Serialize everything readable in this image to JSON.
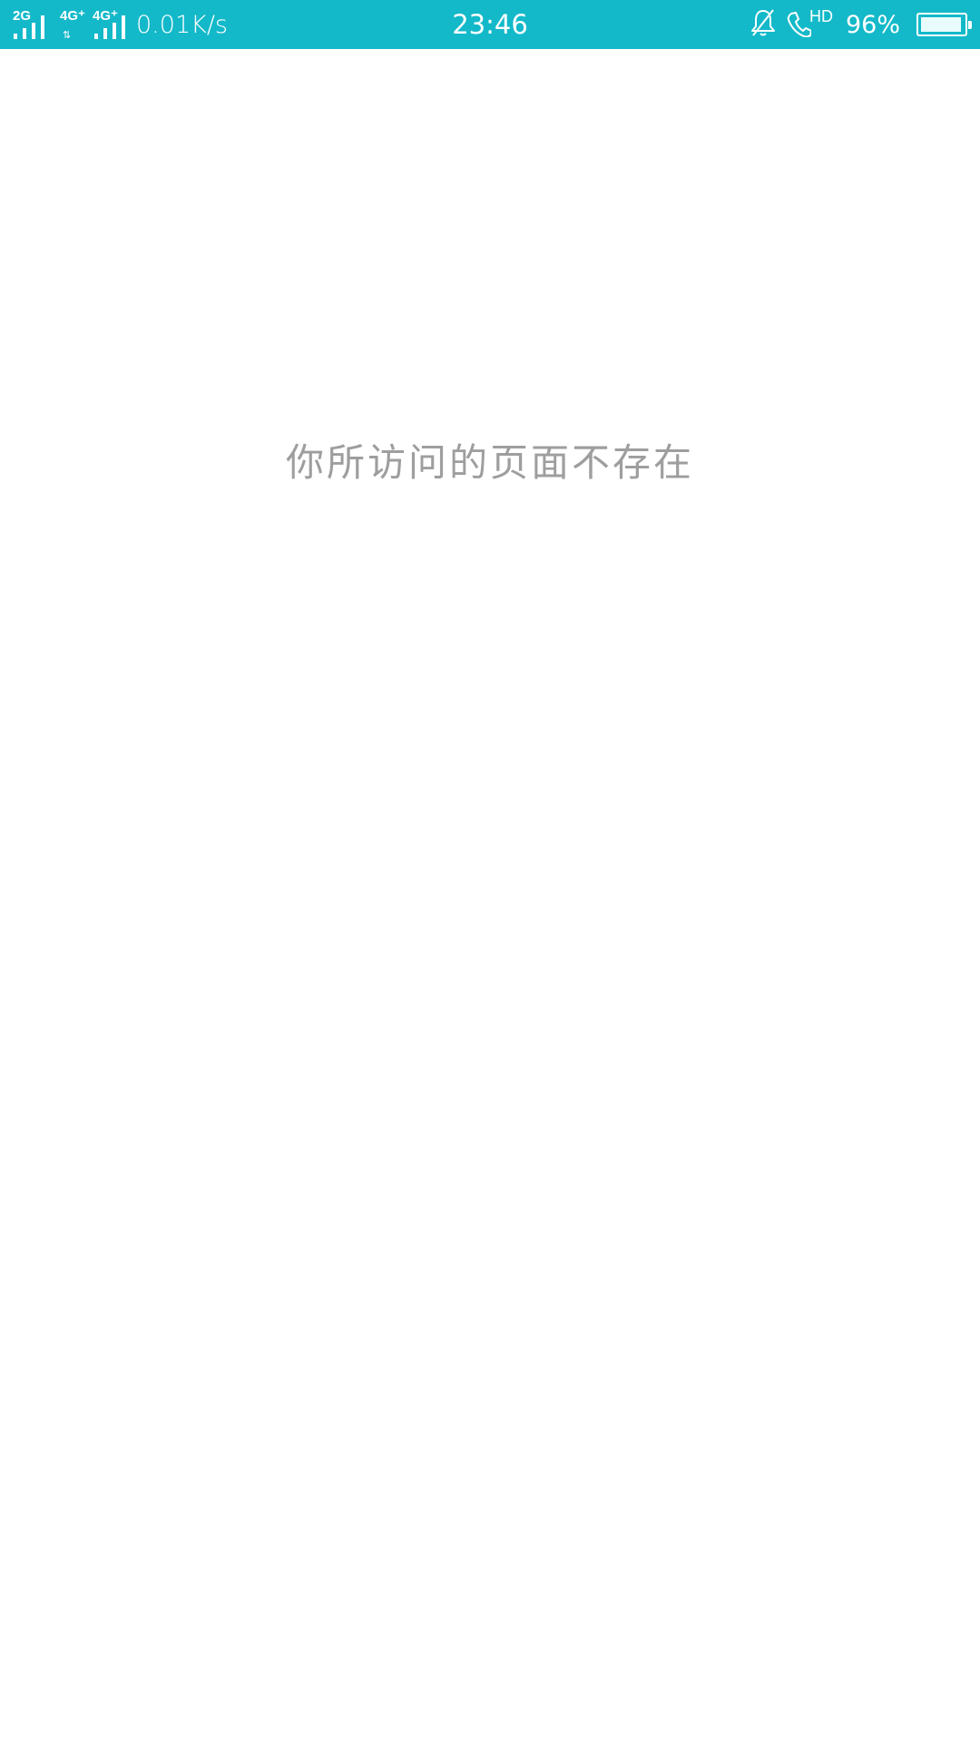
{
  "status_bar": {
    "background_color": "#13b9c9",
    "network_1": {
      "label": "2G",
      "signal_bars": 4
    },
    "network_2": {
      "label": "4G⁺",
      "activity": "⇅"
    },
    "network_3": {
      "label": "4G⁺",
      "signal_bars": 4
    },
    "speed": "0.01K/s",
    "time": "23:46",
    "icons": [
      "notifications-off-icon",
      "hd-call-icon"
    ],
    "hd_label": "HD",
    "battery_percent": "96%",
    "battery_level": 0.96
  },
  "page": {
    "message": "你所访问的页面不存在",
    "message_color": "#9e9e9e"
  }
}
